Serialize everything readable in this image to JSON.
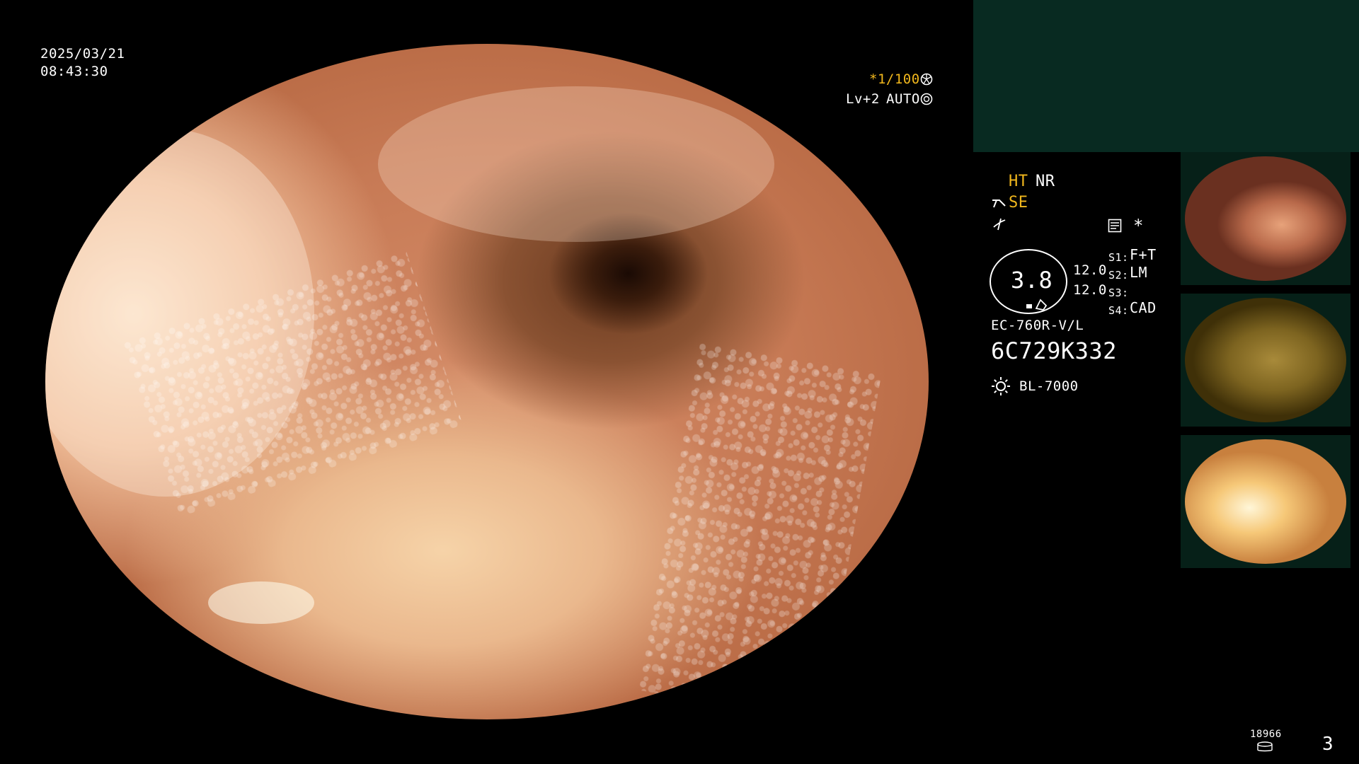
{
  "overlay": {
    "date": "2025/03/21",
    "time": "08:43:30",
    "shutter": "*1/100",
    "shutter_icon": "aperture-icon",
    "level": "Lv+2",
    "mode": "AUTO",
    "mode_icon": "iris-icon"
  },
  "settings": {
    "ht": "HT",
    "nr": "NR",
    "se": "SE",
    "star": "*",
    "zoom_value": "3.8",
    "value_a": "12.0",
    "value_b": "12.0",
    "s1_label": "S1:",
    "s1_value": "F+T",
    "s2_label": "S2:",
    "s2_value": "LM",
    "s3_label": "S3:",
    "s3_value": "",
    "s4_label": "S4:",
    "s4_value": "CAD",
    "scope_model": "EC-760R-V/L",
    "serial": "6C729K332",
    "light_source": "BL-7000"
  },
  "footer": {
    "storage_count": "18966",
    "image_count": "3"
  },
  "colors": {
    "accent_yellow": "#f2b81d",
    "panel_green": "#082a21",
    "text": "#ffffff"
  },
  "icons": [
    "aperture-icon",
    "iris-icon",
    "tube-icon",
    "wave-icon",
    "memo-icon",
    "scope-tip-icon",
    "lamp-icon",
    "storage-icon"
  ]
}
